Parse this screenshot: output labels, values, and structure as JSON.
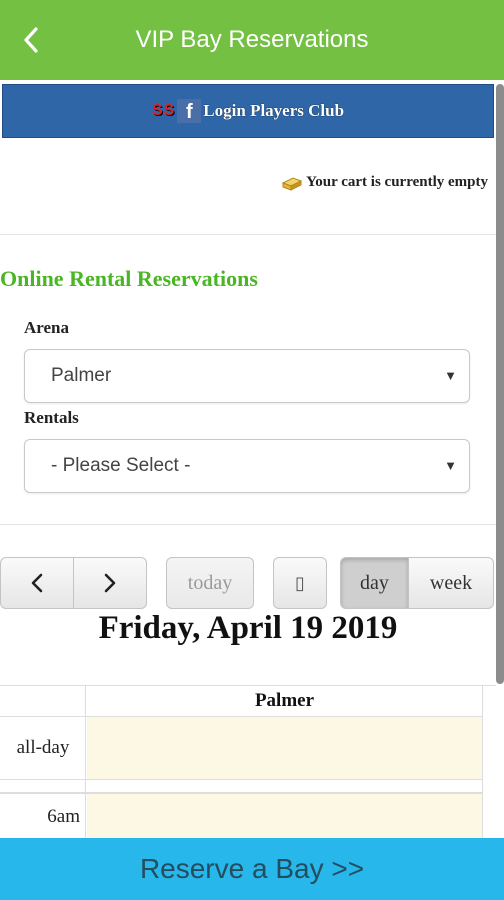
{
  "header": {
    "title": "VIP Bay Reservations",
    "back_icon": "chevron-left-icon",
    "color": "#74c043"
  },
  "login": {
    "label": "Login Players Club",
    "logo_s1": "S",
    "logo_s2": "S",
    "logo_f": "f",
    "color": "#2f66a8"
  },
  "cart": {
    "icon": "cart-box-icon",
    "text": "Your cart is currently empty"
  },
  "form": {
    "title": "Online Rental Reservations",
    "title_color": "#4bb625",
    "arena_label": "Arena",
    "arena_value": "Palmer",
    "rentals_label": "Rentals",
    "rentals_value": "- Please Select -"
  },
  "calendar": {
    "prev_icon": "chevron-left-icon",
    "next_icon": "chevron-right-icon",
    "today_label": "today",
    "blank_button_glyph": "▯",
    "day_label": "day",
    "week_label": "week",
    "date_title": "Friday, April 19 2019",
    "column_header": "Palmer",
    "allday_label": "all-day",
    "time_label": "6am",
    "cell_color": "#fcf8e3"
  },
  "footer": {
    "reserve_label": "Reserve a Bay >>",
    "color": "#27b7ea"
  }
}
